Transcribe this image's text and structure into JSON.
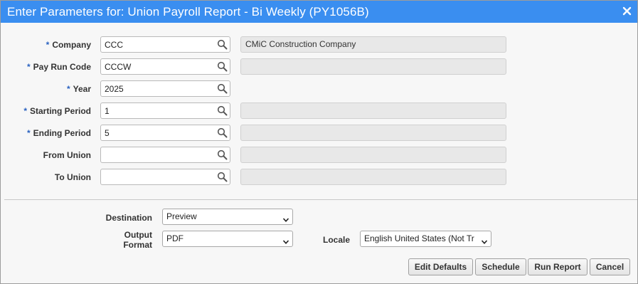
{
  "window": {
    "title": "Enter Parameters for: Union Payroll Report - Bi Weekly (PY1056B)",
    "close_icon": "close-icon"
  },
  "params": [
    {
      "key": "company",
      "required": true,
      "label": "Company",
      "value": "CCC",
      "description": "CMiC Construction Company"
    },
    {
      "key": "pay-run-code",
      "required": true,
      "label": "Pay Run Code",
      "value": "CCCW",
      "description": ""
    },
    {
      "key": "year",
      "required": true,
      "label": "Year",
      "value": "2025",
      "description": null
    },
    {
      "key": "starting-period",
      "required": true,
      "label": "Starting Period",
      "value": "1",
      "description": ""
    },
    {
      "key": "ending-period",
      "required": true,
      "label": "Ending Period",
      "value": "5",
      "description": ""
    },
    {
      "key": "from-union",
      "required": false,
      "label": "From Union",
      "value": "",
      "description": ""
    },
    {
      "key": "to-union",
      "required": false,
      "label": "To Union",
      "value": "",
      "description": ""
    }
  ],
  "required_marker": "*",
  "output": {
    "destination_label": "Destination",
    "destination_value": "Preview",
    "format_label_line1": "Output",
    "format_label_line2": "Format",
    "format_value": "PDF",
    "locale_label": "Locale",
    "locale_value": "English United States (Not Tr"
  },
  "buttons": {
    "edit_defaults": "Edit Defaults",
    "schedule": "Schedule",
    "run_report": "Run Report",
    "cancel": "Cancel"
  },
  "colors": {
    "titlebar": "#3a8ef0",
    "required_marker": "#2a62c0",
    "dialog_background": "#f7f7f7"
  }
}
